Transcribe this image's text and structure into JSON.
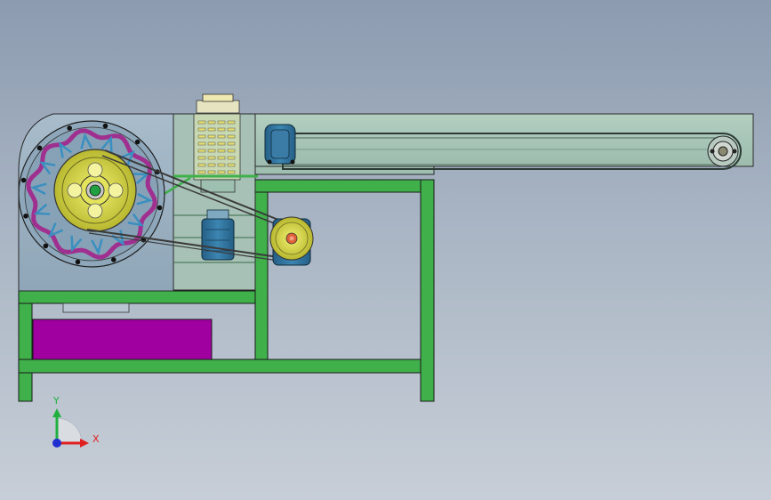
{
  "triad": {
    "x_label": "X",
    "y_label": "Y",
    "x_color": "#e02020",
    "y_color": "#20b040",
    "z_color": "#2030d0"
  },
  "colors": {
    "frame": "#3fb04a",
    "housing": "#9ab0c0",
    "conveyor": "#a8c8b8",
    "flywheel": "#d8d84a",
    "rotor_teeth": "#3a8fc0",
    "rotor_rim": "#a0308f",
    "motor_box": "#a000a0",
    "motor_blue": "#2e6f9a",
    "belt": "#404040"
  }
}
